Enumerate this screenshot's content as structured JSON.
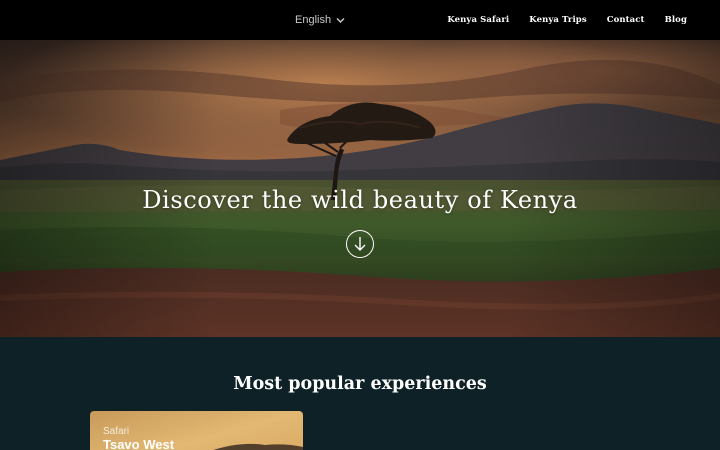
{
  "header": {
    "language": "English",
    "nav": [
      "Kenya Safari",
      "Kenya Trips",
      "Contact",
      "Blog"
    ]
  },
  "hero": {
    "title": "Discover the wild beauty of Kenya",
    "scroll_icon": "arrow-down-circle-icon"
  },
  "popular": {
    "title": "Most popular experiences",
    "cards": [
      {
        "category": "Safari",
        "name": "Tsavo West"
      }
    ]
  },
  "colors": {
    "topbar": "#000000",
    "section_bg": "#0d2126",
    "text": "#ffffff"
  }
}
